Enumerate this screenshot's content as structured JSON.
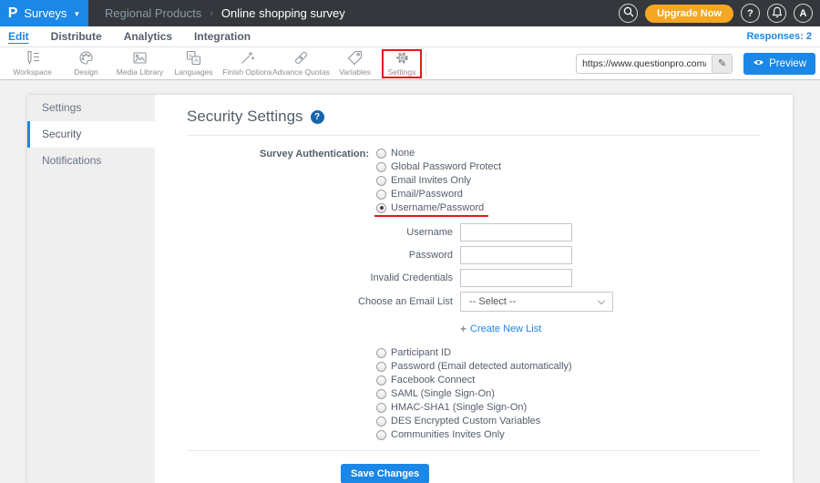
{
  "colors": {
    "brand_blue": "#1b87e6",
    "topbar_dark": "#34383c",
    "upgrade_orange": "#f5a623",
    "annotation_red": "#e01b1b",
    "help_badge_blue": "#1665ab",
    "text_gray": "#545e6b"
  },
  "topbar": {
    "logo_letter": "P",
    "menu_label": "Surveys",
    "breadcrumb_parent": "Regional Products",
    "breadcrumb_sep": "›",
    "breadcrumb_current": "Online shopping survey",
    "upgrade_label": "Upgrade Now",
    "help_label": "?",
    "avatar_label": "A"
  },
  "nav": {
    "tabs": [
      {
        "label": "Edit",
        "active": true
      },
      {
        "label": "Distribute",
        "active": false
      },
      {
        "label": "Analytics",
        "active": false
      },
      {
        "label": "Integration",
        "active": false
      }
    ],
    "responses": "Responses: 2"
  },
  "toolbar": {
    "items": [
      {
        "label": "Workspace",
        "icon": "workspace-icon"
      },
      {
        "label": "Design",
        "icon": "design-icon"
      },
      {
        "label": "Media Library",
        "icon": "media-library-icon"
      },
      {
        "label": "Languages",
        "icon": "languages-icon"
      },
      {
        "label": "Finish Options",
        "icon": "finish-options-icon"
      },
      {
        "label": "Advance Quotas",
        "icon": "advance-quotas-icon"
      },
      {
        "label": "Variables",
        "icon": "variables-icon"
      },
      {
        "label": "Settings",
        "icon": "settings-icon",
        "highlighted": true
      }
    ],
    "url_value": "https://www.questionpro.com/t/APNrfZ",
    "edit_icon": "✎",
    "preview_label": "Preview"
  },
  "sidebar": {
    "items": [
      {
        "label": "Settings",
        "active": false
      },
      {
        "label": "Security",
        "active": true
      },
      {
        "label": "Notifications",
        "active": false
      }
    ]
  },
  "main": {
    "title": "Security Settings",
    "help_label": "?",
    "auth_label": "Survey Authentication:",
    "auth_options": [
      {
        "label": "None",
        "selected": false
      },
      {
        "label": "Global Password Protect",
        "selected": false
      },
      {
        "label": "Email Invites Only",
        "selected": false
      },
      {
        "label": "Email/Password",
        "selected": false
      },
      {
        "label": "Username/Password",
        "selected": true,
        "annotated": true
      }
    ],
    "fields": [
      {
        "label": "Username",
        "value": ""
      },
      {
        "label": "Password",
        "value": ""
      },
      {
        "label": "Invalid Credentials",
        "value": ""
      }
    ],
    "email_list_label": "Choose an Email List",
    "email_list_value": "-- Select --",
    "create_plus": "+",
    "create_new_list_label": "Create New List",
    "extra_options": [
      {
        "label": "Participant ID"
      },
      {
        "label": "Password (Email detected automatically)"
      },
      {
        "label": "Facebook Connect"
      },
      {
        "label": "SAML (Single Sign-On)"
      },
      {
        "label": "HMAC-SHA1 (Single Sign-On)"
      },
      {
        "label": "DES Encrypted Custom Variables"
      },
      {
        "label": "Communities Invites Only"
      }
    ],
    "save_label": "Save Changes"
  }
}
